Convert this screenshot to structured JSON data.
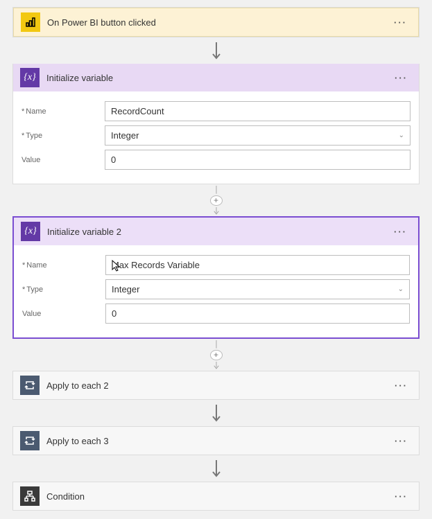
{
  "trigger": {
    "title": "On Power BI button clicked",
    "icon": "powerbi-icon",
    "menu": "···"
  },
  "initVar1": {
    "title": "Initialize variable",
    "menu": "···",
    "fields": {
      "name_label": "Name",
      "name_value": "RecordCount",
      "type_label": "Type",
      "type_value": "Integer",
      "value_label": "Value",
      "value_value": "0"
    }
  },
  "initVar2": {
    "title": "Initialize variable 2",
    "menu": "···",
    "fields": {
      "name_label": "Name",
      "name_value": "Max Records Variable",
      "type_label": "Type",
      "type_value": "Integer",
      "value_label": "Value",
      "value_value": "0"
    }
  },
  "apply2": {
    "title": "Apply to each 2",
    "menu": "···"
  },
  "apply3": {
    "title": "Apply to each 3",
    "menu": "···"
  },
  "condition": {
    "title": "Condition",
    "menu": "···"
  },
  "plus": "+"
}
